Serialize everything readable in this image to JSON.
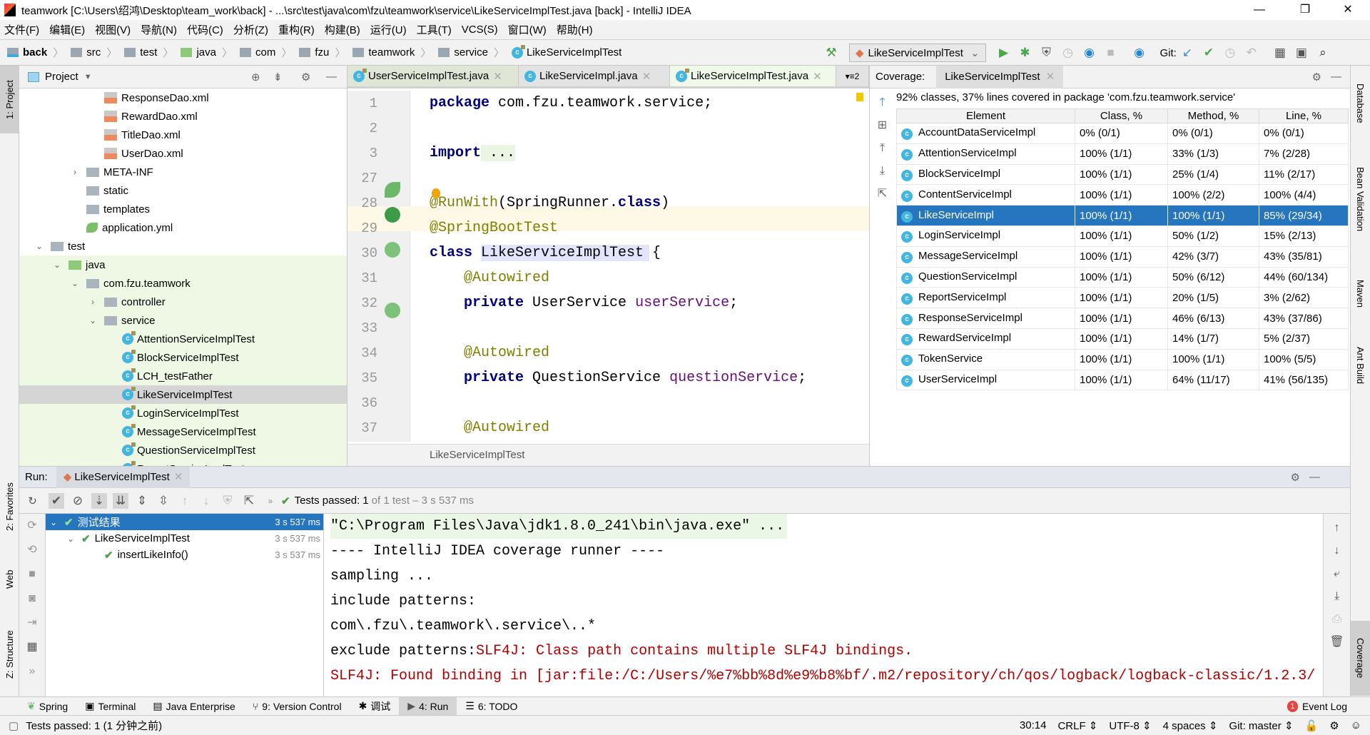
{
  "window": {
    "title": "teamwork [C:\\Users\\绍鸿\\Desktop\\team_work\\back] - ...\\src\\test\\java\\com\\fzu\\teamwork\\service\\LikeServiceImplTest.java [back] - IntelliJ IDEA",
    "minimize": "—",
    "restore": "❐",
    "close": "✕"
  },
  "menu": [
    "文件(F)",
    "编辑(E)",
    "视图(V)",
    "导航(N)",
    "代码(C)",
    "分析(Z)",
    "重构(R)",
    "构建(B)",
    "运行(U)",
    "工具(T)",
    "VCS(S)",
    "窗口(W)",
    "帮助(H)"
  ],
  "breadcrumb": [
    "back",
    "src",
    "test",
    "java",
    "com",
    "fzu",
    "teamwork",
    "service",
    "LikeServiceImplTest"
  ],
  "toolbar": {
    "run_config": "LikeServiceImplTest",
    "git_label": "Git:"
  },
  "left_strip": {
    "project": "1: Project",
    "favorites": "2: Favorites",
    "web": "Web",
    "structure": "Z: Structure"
  },
  "right_strip": {
    "database": "Database",
    "bean": "Bean Validation",
    "maven": "Maven",
    "ant": "Ant Build",
    "coverage": "Coverage"
  },
  "project": {
    "title": "Project",
    "tree": [
      {
        "label": "ResponseDao.xml",
        "type": "xml",
        "depth": 5
      },
      {
        "label": "RewardDao.xml",
        "type": "xml",
        "depth": 5
      },
      {
        "label": "TitleDao.xml",
        "type": "xml",
        "depth": 5
      },
      {
        "label": "UserDao.xml",
        "type": "xml",
        "depth": 5
      },
      {
        "label": "META-INF",
        "type": "folder",
        "depth": 4,
        "arrow": "›"
      },
      {
        "label": "static",
        "type": "folder",
        "depth": 4
      },
      {
        "label": "templates",
        "type": "folder",
        "depth": 4
      },
      {
        "label": "application.yml",
        "type": "yml",
        "depth": 4
      },
      {
        "label": "test",
        "type": "folder",
        "depth": 2,
        "arrow": "⌄"
      },
      {
        "label": "java",
        "type": "green",
        "depth": 3,
        "arrow": "⌄"
      },
      {
        "label": "com.fzu.teamwork",
        "type": "folder",
        "depth": 4,
        "arrow": "⌄"
      },
      {
        "label": "controller",
        "type": "folder",
        "depth": 5,
        "arrow": "›"
      },
      {
        "label": "service",
        "type": "folder",
        "depth": 5,
        "arrow": "⌄"
      },
      {
        "label": "AttentionServiceImplTest",
        "type": "class",
        "depth": 6
      },
      {
        "label": "BlockServiceImplTest",
        "type": "class",
        "depth": 6
      },
      {
        "label": "LCH_testFather",
        "type": "class",
        "depth": 6
      },
      {
        "label": "LikeServiceImplTest",
        "type": "class",
        "depth": 6,
        "selected": true
      },
      {
        "label": "LoginServiceImplTest",
        "type": "class",
        "depth": 6
      },
      {
        "label": "MessageServiceImplTest",
        "type": "class",
        "depth": 6
      },
      {
        "label": "QuestionServiceImplTest",
        "type": "class",
        "depth": 6
      },
      {
        "label": "ReportServiceImplTest",
        "type": "class",
        "depth": 6
      }
    ]
  },
  "editor": {
    "tabs": [
      {
        "label": "UserServiceImplTest.java"
      },
      {
        "label": "LikeServiceImpl.java"
      },
      {
        "label": "LikeServiceImplTest.java",
        "active": true
      }
    ],
    "tab_overflow": "▾≡2",
    "lines": [
      {
        "n": "1",
        "html": [
          [
            "kw",
            "package"
          ],
          [
            "",
            "com.fzu.teamwork.service;"
          ]
        ]
      },
      {
        "n": "2",
        "html": []
      },
      {
        "n": "3",
        "html": [
          [
            "kw",
            "import"
          ],
          [
            "",
            " ..."
          ]
        ]
      },
      {
        "n": "27",
        "html": []
      },
      {
        "n": "28",
        "html": [
          [
            "ann",
            "@RunWith"
          ],
          [
            "",
            "(SpringRunner."
          ],
          [
            "kw",
            "class"
          ],
          [
            "",
            ")"
          ]
        ]
      },
      {
        "n": "29",
        "html": [
          [
            "ann",
            "@SpringBootTest"
          ]
        ]
      },
      {
        "n": "30",
        "html": [
          [
            "kw",
            "class"
          ],
          [
            "",
            " LikeServiceImplTest {"
          ]
        ]
      },
      {
        "n": "31",
        "html": [
          [
            "ann",
            "    @Autowired"
          ]
        ]
      },
      {
        "n": "32",
        "html": [
          [
            "kw",
            "    private"
          ],
          [
            "",
            " UserService "
          ],
          [
            "fld",
            "userService"
          ],
          [
            "",
            ";"
          ]
        ]
      },
      {
        "n": "33",
        "html": []
      },
      {
        "n": "34",
        "html": [
          [
            "ann",
            "    @Autowired"
          ]
        ]
      },
      {
        "n": "35",
        "html": [
          [
            "kw",
            "    private"
          ],
          [
            "",
            " QuestionService "
          ],
          [
            "fld",
            "questionService"
          ],
          [
            "",
            ";"
          ]
        ]
      },
      {
        "n": "36",
        "html": []
      },
      {
        "n": "37",
        "html": [
          [
            "ann",
            "    @Autowired"
          ]
        ]
      }
    ],
    "footer": "LikeServiceImplTest"
  },
  "coverage": {
    "label": "Coverage:",
    "tab": "LikeServiceImplTest",
    "summary": "92% classes, 37% lines covered in package 'com.fzu.teamwork.service'",
    "columns": [
      "Element",
      "Class, %",
      "Method, %",
      "Line, %"
    ],
    "rows": [
      [
        "AccountDataServiceImpl",
        "0% (0/1)",
        "0% (0/1)",
        "0% (0/1)"
      ],
      [
        "AttentionServiceImpl",
        "100% (1/1)",
        "33% (1/3)",
        "7% (2/28)"
      ],
      [
        "BlockServiceImpl",
        "100% (1/1)",
        "25% (1/4)",
        "11% (2/17)"
      ],
      [
        "ContentServiceImpl",
        "100% (1/1)",
        "100% (2/2)",
        "100% (4/4)"
      ],
      [
        "LikeServiceImpl",
        "100% (1/1)",
        "100% (1/1)",
        "85% (29/34)"
      ],
      [
        "LoginServiceImpl",
        "100% (1/1)",
        "50% (1/2)",
        "15% (2/13)"
      ],
      [
        "MessageServiceImpl",
        "100% (1/1)",
        "42% (3/7)",
        "43% (35/81)"
      ],
      [
        "QuestionServiceImpl",
        "100% (1/1)",
        "50% (6/12)",
        "44% (60/134)"
      ],
      [
        "ReportServiceImpl",
        "100% (1/1)",
        "20% (1/5)",
        "3% (2/62)"
      ],
      [
        "ResponseServiceImpl",
        "100% (1/1)",
        "46% (6/13)",
        "43% (37/86)"
      ],
      [
        "RewardServiceImpl",
        "100% (1/1)",
        "14% (1/7)",
        "5% (2/37)"
      ],
      [
        "TokenService",
        "100% (1/1)",
        "100% (1/1)",
        "100% (5/5)"
      ],
      [
        "UserServiceImpl",
        "100% (1/1)",
        "64% (11/17)",
        "41% (56/135)"
      ]
    ],
    "selected_row": 4
  },
  "run": {
    "label": "Run:",
    "tab": "LikeServiceImplTest",
    "status_prefix": "Tests passed:",
    "status_count": "1",
    "status_rest": "of 1 test – 3 s 537 ms",
    "tree": [
      {
        "label": "测试结果",
        "time": "3 s 537 ms",
        "selected": true
      },
      {
        "label": "LikeServiceImplTest",
        "time": "3 s 537 ms"
      },
      {
        "label": "insertLikeInfo()",
        "time": "3 s 537 ms"
      }
    ],
    "console": [
      "\"C:\\Program Files\\Java\\jdk1.8.0_241\\bin\\java.exe\" ...",
      "---- IntelliJ IDEA coverage runner ----",
      "sampling ...",
      "include patterns:",
      "com\\.fzu\\.teamwork\\.service\\..*",
      "exclude patterns:",
      "SLF4J: Class path contains multiple SLF4J bindings.",
      "SLF4J: Found binding in [jar:file:/C:/Users/%e7%bb%8d%e9%b8%bf/.m2/repository/ch/qos/logback/logback-classic/1.2.3/"
    ]
  },
  "toolwindows": [
    "Spring",
    "Terminal",
    "Java Enterprise",
    "9: Version Control",
    "调试",
    "4: Run",
    "6: TODO"
  ],
  "event_log": {
    "label": "Event Log",
    "count": "1"
  },
  "status": {
    "message": "Tests passed: 1 (1 分钟之前)",
    "position": "30:14",
    "line_sep": "CRLF",
    "encoding": "UTF-8",
    "indent": "4 spaces",
    "git": "Git: master"
  },
  "colors": {
    "selection": "#2675bf",
    "pass": "#4ca04c",
    "error": "#b00000",
    "annotation": "#808000",
    "keyword": "#000080"
  }
}
